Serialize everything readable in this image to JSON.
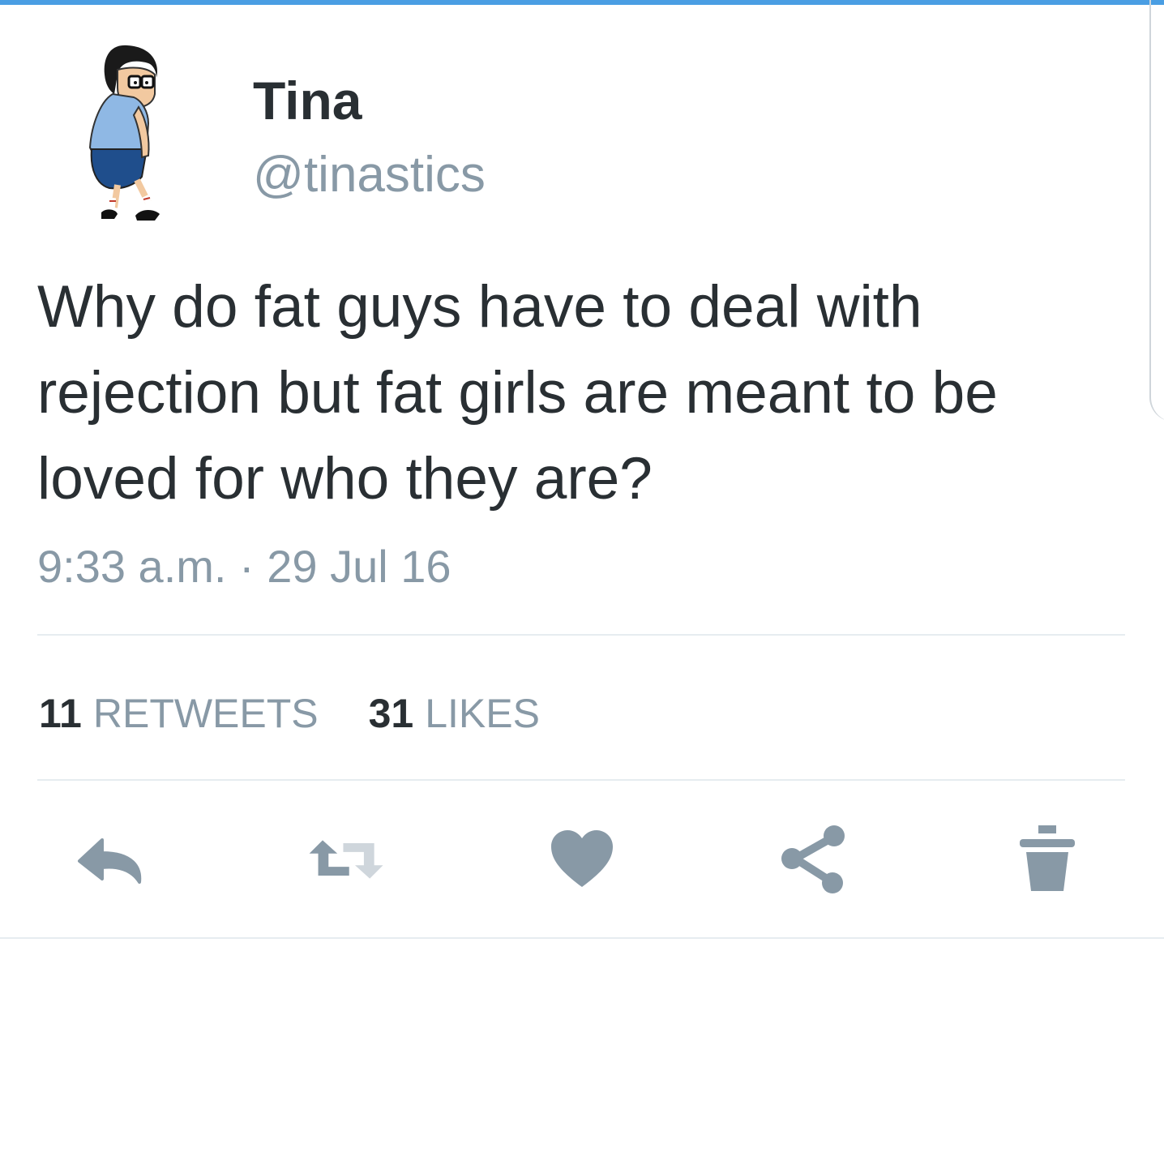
{
  "tweet": {
    "display_name": "Tina",
    "handle": "@tinastics",
    "text": "Why do fat guys have to deal with rejection but fat girls are meant to be loved for who they are?",
    "timestamp": "9:33 a.m. · 29 Jul 16"
  },
  "stats": {
    "retweets_count": "11",
    "retweets_label": "RETWEETS",
    "likes_count": "31",
    "likes_label": "LIKES"
  },
  "actions": {
    "reply_icon": "reply-icon",
    "retweet_icon": "retweet-icon",
    "like_icon": "heart-icon",
    "share_icon": "share-icon",
    "delete_icon": "trash-icon"
  },
  "colors": {
    "accent_bar": "#4a9ee3",
    "icon_gray": "#8899a6",
    "text_dark": "#292f33"
  }
}
